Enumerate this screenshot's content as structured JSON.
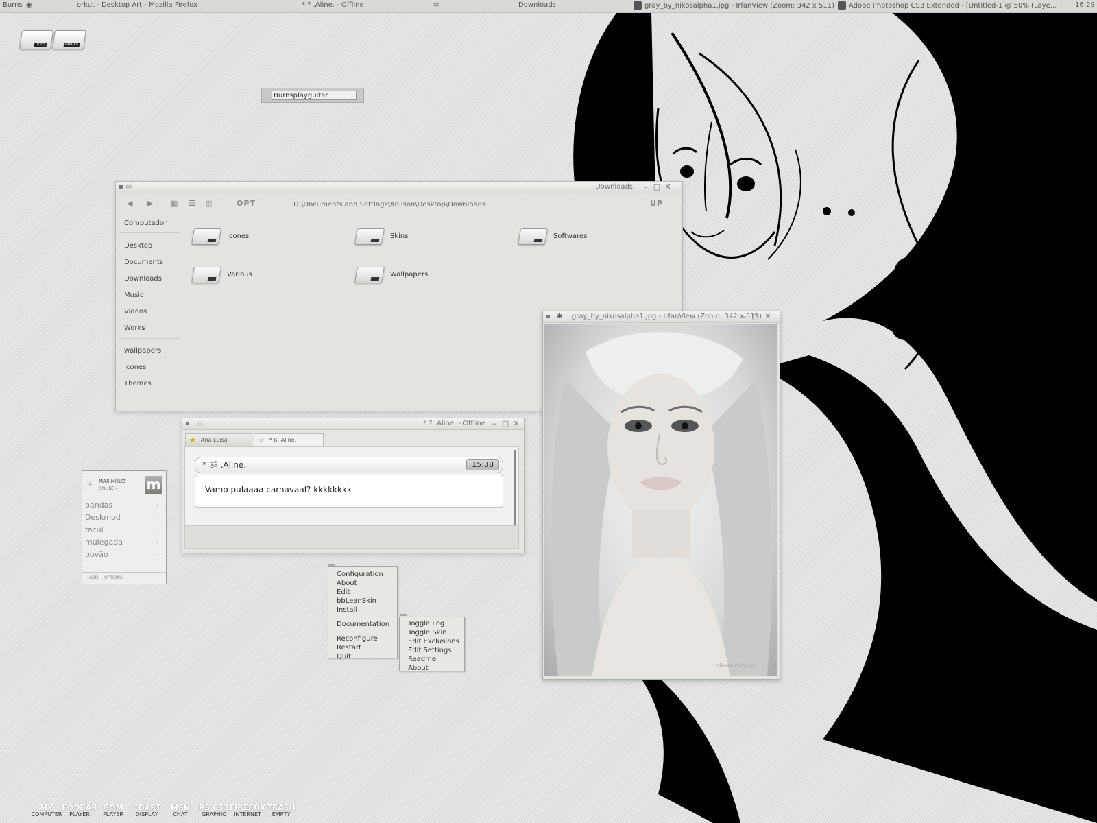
{
  "topbar": {
    "user": "Burns",
    "tasks": [
      "orkut - Desktop Art - Mozilla Firefox",
      "* ? .Aline. - Offline",
      "Downloads",
      "gray_by_nikosalpha1.jpg - IrfanView (Zoom: 342 x 511)",
      "Adobe Photoshop CS3 Extended - [Untitled-1 @ 50% (Laye..."
    ],
    "clock": "16:29"
  },
  "desktop_drives": [
    "DOCS",
    "IMAGES"
  ],
  "user_input": {
    "value": "Burnsplayguitar"
  },
  "explorer": {
    "title": "Downloads",
    "nav": {
      "back": "◀",
      "forward": "▶",
      "opt": "OPT",
      "up": "UP"
    },
    "path": "D:\\Documents and Settings\\Adilson\\Desktop\\Downloads",
    "sidebar": {
      "computer": "Computador",
      "group1": [
        "Desktop",
        "Documents",
        "Downloads",
        "Music",
        "Videos",
        "Works"
      ],
      "group2": [
        "wallpapers",
        "Icones",
        "Themes"
      ]
    },
    "folders": [
      "Icones",
      "Skins",
      "Softwares",
      "Various",
      "Wallpapers"
    ]
  },
  "chat": {
    "title": "* ? .Aline. - Offline",
    "tabs": [
      "Ana Luísa",
      "* ß .Aline."
    ],
    "message": {
      "sender": "* ૐ .Aline.",
      "time": "15:38",
      "text": "Vamo pulaaaa carnavaal? kkkkkkkk"
    }
  },
  "msn": {
    "nick": "MAXIMHUZ",
    "status": "ONLINE ▾",
    "groups": [
      "bandas",
      "Deskmod",
      "facul",
      "muiegada",
      "povão"
    ],
    "footer": {
      "add": "ADD",
      "options": "OPTIONS"
    }
  },
  "menu_main": {
    "items": [
      "Configuration",
      "About",
      "Edit",
      "bbLeanSkin",
      "Install",
      "Documentation",
      "Reconfigure",
      "Restart",
      "Quit"
    ]
  },
  "menu_sub": {
    "items": [
      "Toggle Log",
      "Toggle Skin",
      "Edit Exclusions",
      "Edit Settings",
      "Readme",
      "About"
    ]
  },
  "irfanview": {
    "title": "gray_by_nikosalpha1.jpg - IrfanView (Zoom: 342 x 511)",
    "watermark": "nikosalpha.com"
  },
  "dock": [
    {
      "top": "MY",
      "bottom": "COMPUTER"
    },
    {
      "top": "FOOBAR",
      "bottom": "PLAYER"
    },
    {
      "top": "GOM",
      "bottom": "PLAYER"
    },
    {
      "top": "CDART",
      "bottom": "DISPLAY"
    },
    {
      "top": "MSN",
      "bottom": "CHAT"
    },
    {
      "top": "PS CS3",
      "bottom": "GRAPHIC"
    },
    {
      "top": "FIREFOX",
      "bottom": "INTERNET"
    },
    {
      "top": "TRASH",
      "bottom": "EMPTY"
    }
  ],
  "colors": {
    "background": "#dcdcda",
    "window": "#e3e3e0",
    "text": "#333333",
    "art": "#000000"
  }
}
